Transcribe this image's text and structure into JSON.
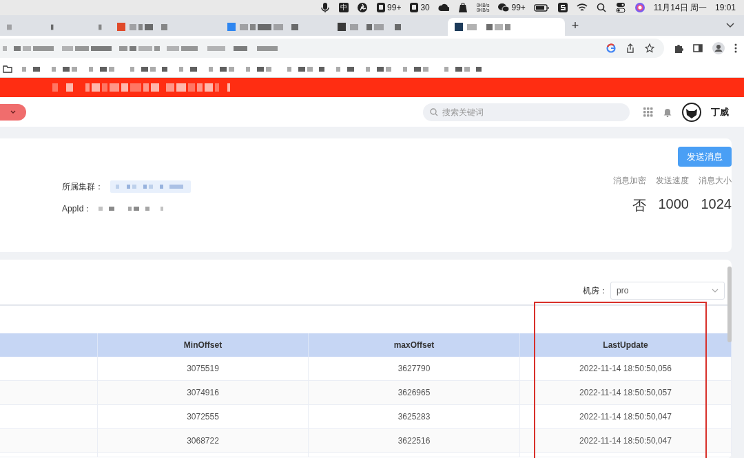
{
  "menu_bar": {
    "items": [
      {
        "kind": "mic"
      },
      {
        "kind": "text",
        "text": "中"
      },
      {
        "kind": "fan"
      },
      {
        "kind": "badge",
        "text": "99+"
      },
      {
        "kind": "badge",
        "text": "30"
      },
      {
        "kind": "cloud"
      },
      {
        "kind": "bag"
      },
      {
        "kind": "net",
        "lines": [
          "0KB/s",
          "0KB/s"
        ]
      },
      {
        "kind": "chat",
        "text": "99+"
      },
      {
        "kind": "battery"
      },
      {
        "kind": "s"
      },
      {
        "kind": "wifi"
      },
      {
        "kind": "search"
      },
      {
        "kind": "toggle"
      },
      {
        "kind": "siri"
      }
    ],
    "date": "11月14日 周一",
    "time": "19:01"
  },
  "browser": {
    "tabs": [
      {
        "selected": false
      },
      {
        "selected": false
      },
      {
        "selected": false
      },
      {
        "selected": false
      },
      {
        "selected": true
      }
    ],
    "new_tab": "+"
  },
  "header": {
    "search": {
      "placeholder": "搜索关键词"
    },
    "user": "丁威"
  },
  "info_card": {
    "button": "发送消息",
    "fields": [
      {
        "label": "所属集群："
      },
      {
        "label": "AppId："
      }
    ],
    "stats": [
      {
        "label": "消息加密",
        "value": "否"
      },
      {
        "label": "发送速度",
        "value": "1000"
      },
      {
        "label": "消息大小",
        "value": "1024"
      }
    ]
  },
  "table_card": {
    "filter": {
      "label": "机房：",
      "value": "pro"
    },
    "table": {
      "columns": [
        "MinOffset",
        "maxOffset",
        "LastUpdate"
      ],
      "rows": [
        [
          "3075519",
          "3627790",
          "2022-11-14 18:50:50,056"
        ],
        [
          "3074916",
          "3626965",
          "2022-11-14 18:50:50,057"
        ],
        [
          "3072555",
          "3625283",
          "2022-11-14 18:50:50,047"
        ],
        [
          "3068722",
          "3622516",
          "2022-11-14 18:50:50,047"
        ]
      ]
    }
  }
}
